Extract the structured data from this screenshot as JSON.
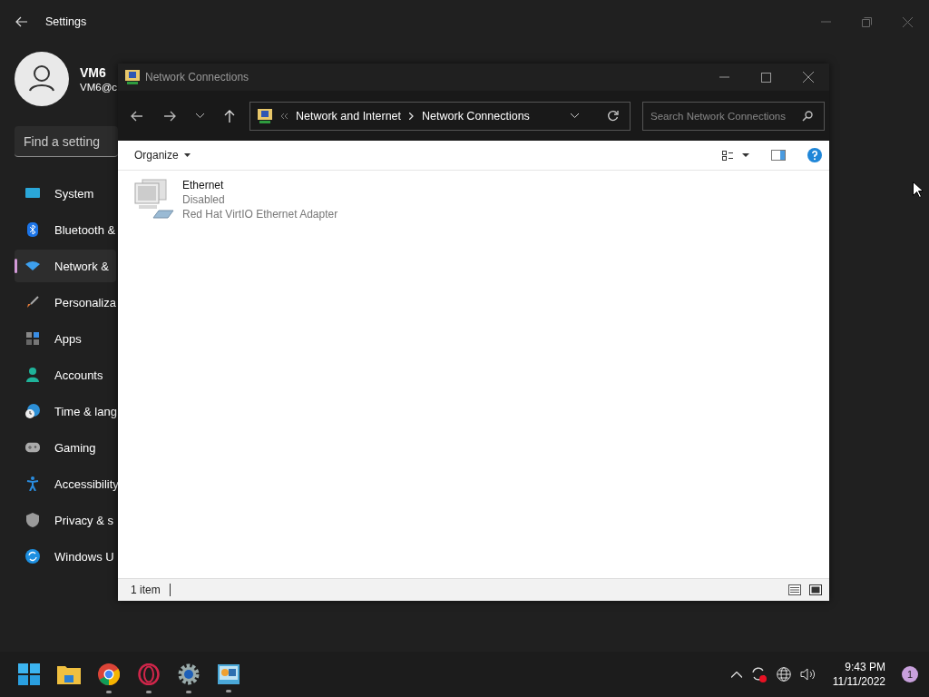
{
  "settings": {
    "title": "Settings",
    "profile": {
      "name": "VM6",
      "email": "VM6@c"
    },
    "search": {
      "placeholder": "Find a setting"
    },
    "nav": [
      {
        "label": "System",
        "selected": false
      },
      {
        "label": "Bluetooth &",
        "selected": false
      },
      {
        "label": "Network &",
        "selected": true
      },
      {
        "label": "Personaliza",
        "selected": false
      },
      {
        "label": "Apps",
        "selected": false
      },
      {
        "label": "Accounts",
        "selected": false
      },
      {
        "label": "Time & lang",
        "selected": false
      },
      {
        "label": "Gaming",
        "selected": false
      },
      {
        "label": "Accessibility",
        "selected": false
      },
      {
        "label": "Privacy & s",
        "selected": false
      },
      {
        "label": "Windows U",
        "selected": false
      }
    ]
  },
  "explorer": {
    "title": "Network Connections",
    "address": {
      "crumbs": [
        "Network and Internet",
        "Network Connections"
      ]
    },
    "search": {
      "placeholder": "Search Network Connections"
    },
    "organize": "Organize",
    "items": [
      {
        "name": "Ethernet",
        "status": "Disabled",
        "device": "Red Hat VirtIO Ethernet Adapter",
        "disabled": true
      }
    ],
    "status_bar": {
      "count": "1 item"
    }
  },
  "taskbar": {
    "apps": [
      {
        "kind": "start",
        "running": false
      },
      {
        "kind": "folder",
        "running": false
      },
      {
        "kind": "browser",
        "running": true
      },
      {
        "kind": "ring",
        "running": true
      },
      {
        "kind": "gear",
        "running": true
      },
      {
        "kind": "netapp",
        "running": true
      }
    ],
    "time": "9:43 PM",
    "date": "11/11/2022",
    "notifications": "1"
  }
}
